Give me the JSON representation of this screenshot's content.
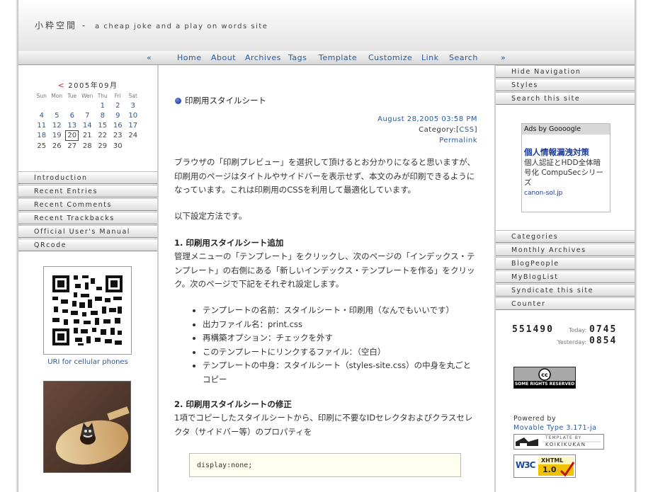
{
  "header": {
    "title": "小粋空間",
    "dash": "-",
    "tagline": "a cheap joke and a play on words site"
  },
  "nav": {
    "prev": "«",
    "next": "»",
    "items": [
      "Home",
      "About",
      "Archives",
      "Tags",
      "Template",
      "Customize",
      "Link",
      "Search"
    ]
  },
  "calendar": {
    "prev": "<",
    "title": "2005年09月",
    "weekdays": [
      "Sun",
      "Mon",
      "Tue",
      "Wen",
      "Thu",
      "Fri",
      "Sat"
    ],
    "weeks": [
      [
        "",
        "",
        "",
        "",
        "1",
        "2",
        "3"
      ],
      [
        "4",
        "5",
        "6",
        "7",
        "8",
        "9",
        "10"
      ],
      [
        "11",
        "12",
        "13",
        "14",
        "15",
        "16",
        "17"
      ],
      [
        "18",
        "19",
        "20",
        "21",
        "22",
        "23",
        "24"
      ],
      [
        "25",
        "26",
        "27",
        "28",
        "29",
        "30",
        ""
      ]
    ],
    "today": "20"
  },
  "left_menu": [
    "Introduction",
    "Recent Entries",
    "Recent Comments",
    "Recent Trackbacks",
    "Official User's Manual",
    "QRcode"
  ],
  "qr_caption": "URI for cellular phones",
  "post": {
    "title": "印刷用スタイルシート",
    "date": "August 28,2005 03:58 PM",
    "category_label": "Category:[",
    "category": "CSS",
    "category_end": "]",
    "permalink": "Permalink",
    "intro": "ブラウザの「印刷プレビュー」を選択して頂けるとお分かりになると思いますが、印刷用のページはタイトルやサイドバーを表示せず、本文のみが印刷できるようになっています。これは印刷用のCSSを利用して最適化しています。",
    "howto": "以下設定方法です。",
    "step1_title": "1. 印刷用スタイルシート追加",
    "step1_text": "管理メニューの「テンプレート」をクリックし、次のページの「インデックス・テンプレート」の右側にある「新しいインデックス・テンプレートを作る」をクリック。次のページで下記をそれぞれ設定します。",
    "bullets": [
      "テンプレートの名前：スタイルシート・印刷用（なんでもいいです）",
      "出力ファイル名：print.css",
      "再構築オプション：チェックを外す",
      "このテンプレートにリンクするファイル：（空白）",
      "テンプレートの中身：スタイルシート（styles-site.css）の中身を丸ごとコピー"
    ],
    "step2_title": "2. 印刷用スタイルシートの修正",
    "step2_text": "1項でコピーしたスタイルシートから、印刷に不要なIDセレクタおよびクラスセレクタ（サイドバー等）のプロパティを",
    "code": "display:none;"
  },
  "right_menu_top": [
    "Hide Navigation",
    "Styles",
    "Search this site"
  ],
  "ads": {
    "head": "Ads by Goooogle",
    "title": "個人情報漏洩対策",
    "body": "個人認証とHDD全体暗号化 CompuSecシリーズ",
    "url": "canon-sol.jp"
  },
  "right_menu_bottom": [
    "Categories",
    "Monthly Archives",
    "BlogPeople",
    "MyBlogList",
    "Syndicate this site",
    "Counter"
  ],
  "counter": {
    "total": "551490",
    "today_label": "Today:",
    "today": "0745",
    "yesterday_label": "Yesterday:",
    "yesterday": "0854"
  },
  "cc_badge": "SOME RIGHTS RESERVED",
  "powered": {
    "label": "Powered by",
    "link": "Movable Type 3.171-ja"
  },
  "template_badge": {
    "top": "TEMPLATE BY",
    "name": "KOIKIKUKAN"
  },
  "w3c_badge": {
    "w3c": "W3C",
    "xhtml": "XHTML",
    "version": "1.0"
  },
  "colors": {
    "link": "#2a5a9a",
    "ads_title": "#1a3a9a",
    "sun": "#d05050",
    "sat": "#5070c0"
  }
}
